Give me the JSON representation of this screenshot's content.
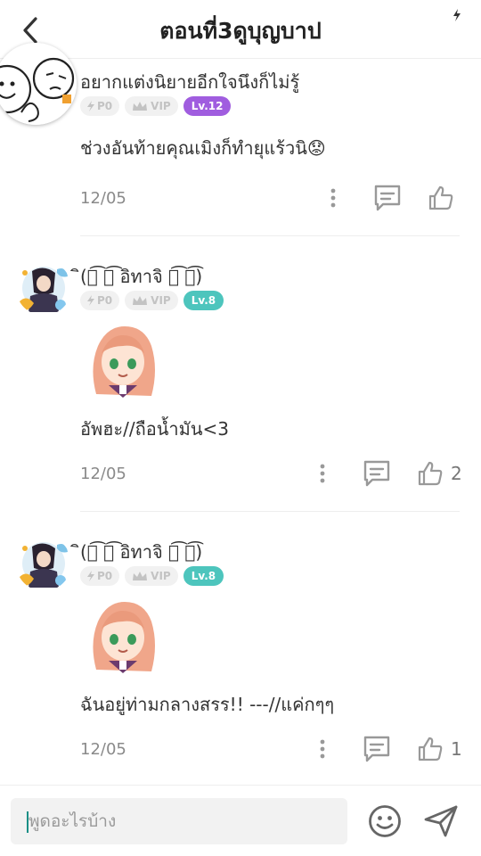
{
  "header": {
    "title": "ตอนที่3ดูบุญบาป"
  },
  "comments": [
    {
      "username": "อยากแต่งนิยายอีกใจนึงก็ไม่รู้",
      "badges": {
        "p": "P0",
        "vip": "VIP",
        "level": "Lv.12"
      },
      "text": "ช่วงอันท้ายคุณเมิงก็ทำยุแร้วนิ😟",
      "date": "12/05",
      "likes": ""
    },
    {
      "username": "ิ(ิ͡ ิ͡ อิทาจิ ิ͡ ิ͡)",
      "badges": {
        "p": "P0",
        "vip": "VIP",
        "level": "Lv.8"
      },
      "text": "อัพฮะ//ถือน้ำมัน<3",
      "date": "12/05",
      "likes": "2"
    },
    {
      "username": "ิ(ิ͡ ิ͡ อิทาจิ ิ͡ ิ͡)",
      "badges": {
        "p": "P0",
        "vip": "VIP",
        "level": "Lv.8"
      },
      "text": "ฉันอยู่ท่ามกลางสรร!! ---//แค่กๆๆ",
      "date": "12/05",
      "likes": "1"
    }
  ],
  "composer": {
    "placeholder": "พูดอะไรบ้าง"
  },
  "colors": {
    "level12": "#a05ddf",
    "level8": "#4dc5bd",
    "caret": "#1a8f86"
  }
}
